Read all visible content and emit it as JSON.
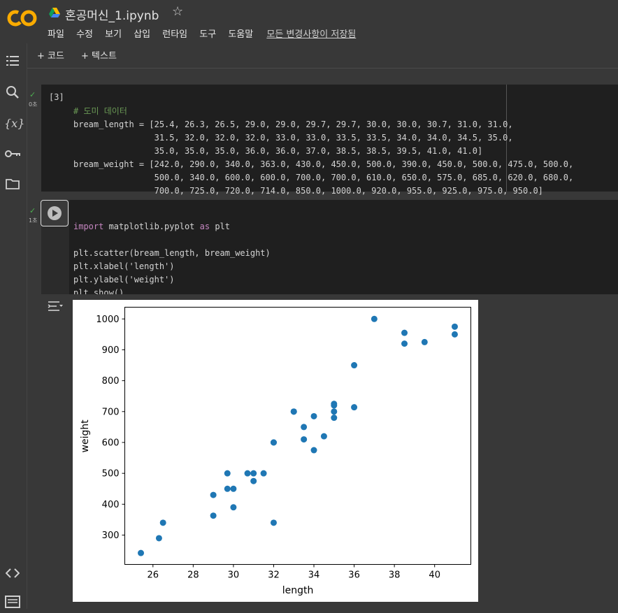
{
  "header": {
    "logo_text": "CO",
    "title": "혼공머신_1.ipynb",
    "menu": [
      "파일",
      "수정",
      "보기",
      "삽입",
      "런타임",
      "도구",
      "도움말"
    ],
    "saved_status": "모든 변경사항이 저장됨"
  },
  "toolbar": {
    "add_code": "코드",
    "add_text": "텍스트"
  },
  "sidebar_icons": [
    "table-of-contents-icon",
    "search-icon",
    "variables-icon",
    "key-icon",
    "folder-icon",
    "code-snippets-icon",
    "terminal-icon"
  ],
  "cells": [
    {
      "exec_count": "[3]",
      "exec_time": "0초",
      "lines": [
        "# 도미 데이터",
        "bream_length = [25.4, 26.3, 26.5, 29.0, 29.0, 29.7, 29.7, 30.0, 30.0, 30.7, 31.0, 31.0,",
        "                31.5, 32.0, 32.0, 32.0, 33.0, 33.0, 33.5, 33.5, 34.0, 34.0, 34.5, 35.0,",
        "                35.0, 35.0, 35.0, 36.0, 36.0, 37.0, 38.5, 38.5, 39.5, 41.0, 41.0]",
        "bream_weight = [242.0, 290.0, 340.0, 363.0, 430.0, 450.0, 500.0, 390.0, 450.0, 500.0, 475.0, 500.0,",
        "                500.0, 340.0, 600.0, 600.0, 700.0, 700.0, 610.0, 650.0, 575.0, 685.0, 620.0, 680.0,",
        "                700.0, 725.0, 720.0, 714.0, 850.0, 1000.0, 920.0, 955.0, 925.0, 975.0, 950.0]"
      ]
    },
    {
      "exec_time": "1초",
      "lines": [
        "import matplotlib.pyplot as plt",
        "",
        "plt.scatter(bream_length, bream_weight)",
        "plt.xlabel('length')",
        "plt.ylabel('weight')",
        "plt.show()"
      ]
    }
  ],
  "chart_data": {
    "type": "scatter",
    "xlabel": "length",
    "ylabel": "weight",
    "xlim": [
      24.6,
      41.8
    ],
    "ylim": [
      205,
      1038
    ],
    "xticks": [
      26,
      28,
      30,
      32,
      34,
      36,
      38,
      40
    ],
    "yticks": [
      300,
      400,
      500,
      600,
      700,
      800,
      900,
      1000
    ],
    "color": "#1f77b4",
    "x": [
      25.4,
      26.3,
      26.5,
      29.0,
      29.0,
      29.7,
      29.7,
      30.0,
      30.0,
      30.7,
      31.0,
      31.0,
      31.5,
      32.0,
      32.0,
      32.0,
      33.0,
      33.0,
      33.5,
      33.5,
      34.0,
      34.0,
      34.5,
      35.0,
      35.0,
      35.0,
      35.0,
      36.0,
      36.0,
      37.0,
      38.5,
      38.5,
      39.5,
      41.0,
      41.0
    ],
    "y": [
      242.0,
      290.0,
      340.0,
      363.0,
      430.0,
      450.0,
      500.0,
      390.0,
      450.0,
      500.0,
      475.0,
      500.0,
      500.0,
      340.0,
      600.0,
      600.0,
      700.0,
      700.0,
      610.0,
      650.0,
      575.0,
      685.0,
      620.0,
      680.0,
      700.0,
      725.0,
      720.0,
      714.0,
      850.0,
      1000.0,
      920.0,
      955.0,
      925.0,
      975.0,
      950.0
    ]
  }
}
